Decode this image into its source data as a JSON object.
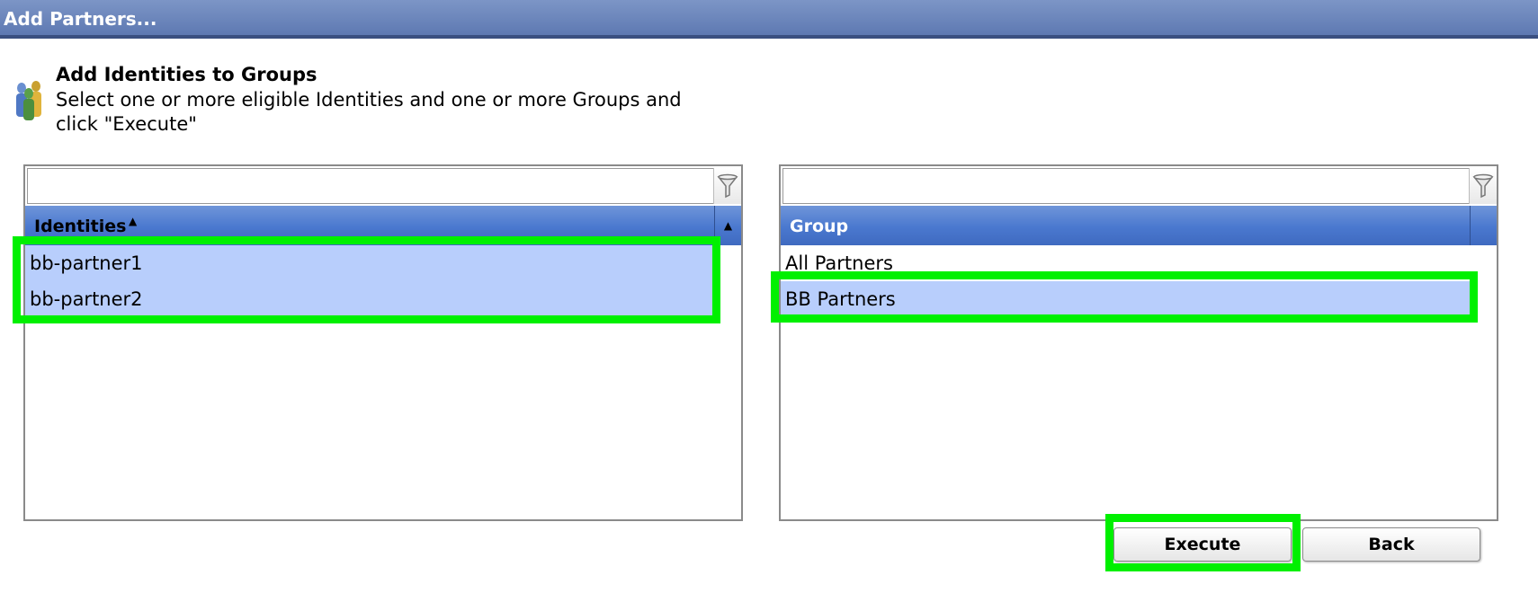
{
  "window": {
    "title": "Add Partners..."
  },
  "header": {
    "heading": "Add Identities to Groups",
    "description": "Select one or more eligible Identities and one or more Groups and click \"Execute\"",
    "icon": "people-group-icon"
  },
  "identities_panel": {
    "filter_value": "",
    "column_header": "Identities",
    "sort": "ascending",
    "rows": [
      {
        "label": "bb-partner1",
        "selected": true
      },
      {
        "label": "bb-partner2",
        "selected": true
      }
    ]
  },
  "groups_panel": {
    "filter_value": "",
    "column_header": "Group",
    "rows": [
      {
        "label": "All Partners",
        "selected": false
      },
      {
        "label": "BB Partners",
        "selected": true
      }
    ]
  },
  "buttons": {
    "execute": "Execute",
    "back": "Back"
  },
  "colors": {
    "titlebar": "#6a84bb",
    "column_header": "#4a78cf",
    "selection": "#b8cefc",
    "highlight": "#00f000"
  }
}
